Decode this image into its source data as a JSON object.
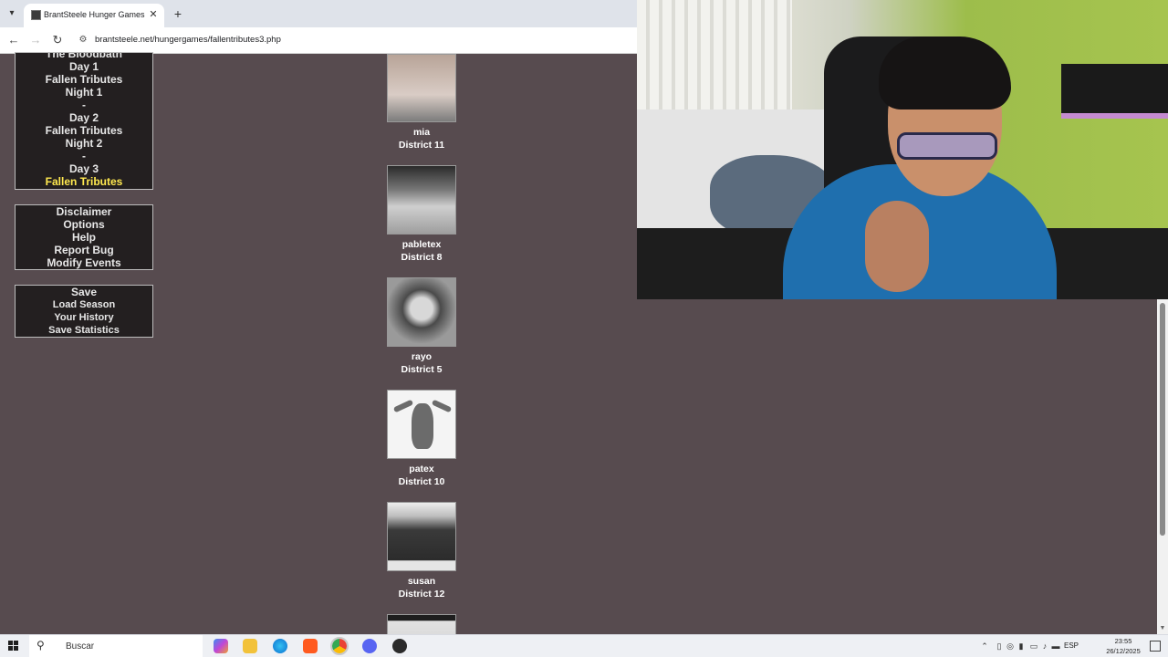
{
  "browser": {
    "tab_title": "BrantSteele Hunger Games Sim",
    "url": "brantsteele.net/hungergames/fallentributes3.php",
    "new_tab_glyph": "+",
    "close_glyph": "✕"
  },
  "menu_events": [
    "The Bloodbath",
    "Day 1",
    "Fallen Tributes",
    "Night 1",
    "-",
    "Day 2",
    "Fallen Tributes",
    "Night 2",
    "-",
    "Day 3",
    "Fallen Tributes"
  ],
  "menu_info": [
    "Disclaimer",
    "Options",
    "Help",
    "Report Bug",
    "Modify Events"
  ],
  "menu_save": [
    "Save",
    "Load Season",
    "Your History",
    "Save Statistics"
  ],
  "tributes": [
    {
      "name": "mia",
      "district": "District 11"
    },
    {
      "name": "pabletex",
      "district": "District 8"
    },
    {
      "name": "rayo",
      "district": "District 5"
    },
    {
      "name": "patex",
      "district": "District 10"
    },
    {
      "name": "susan",
      "district": "District 12"
    }
  ],
  "taskbar": {
    "search_placeholder": "Buscar",
    "language": "ESP",
    "time": "23:55",
    "date": "26/12/2025"
  },
  "colors": {
    "page_bg": "#574b4f",
    "menu_bg": "#231f20",
    "active_link": "#ffe94f"
  }
}
